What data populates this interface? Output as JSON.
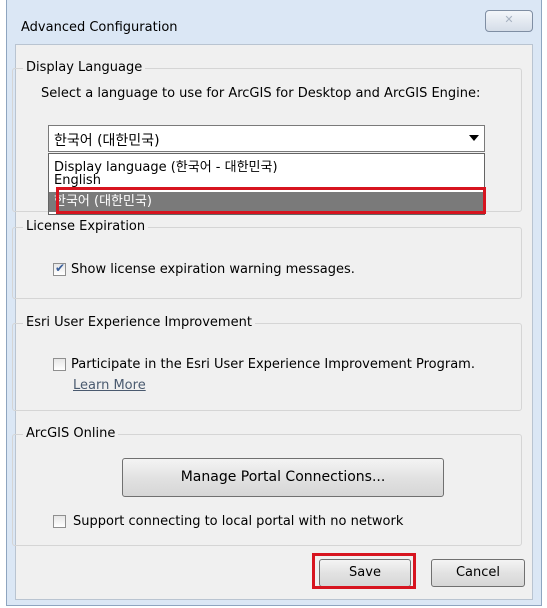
{
  "window": {
    "title": "Advanced Configuration",
    "close_glyph": "✕"
  },
  "display_language": {
    "legend": "Display Language",
    "instruction": "Select a language to use for ArcGIS for Desktop and ArcGIS Engine:",
    "selected_value": "한국어 (대한민국)",
    "options": [
      "Display language (한국어 - 대한민국)",
      "English",
      "한국어 (대한민국)"
    ],
    "highlighted_option_index": 2
  },
  "license_expiration": {
    "legend": "License Expiration",
    "checkbox_label": "Show license expiration warning messages.",
    "checked": true
  },
  "uei": {
    "legend": "Esri User Experience Improvement",
    "checkbox_label": "Participate in the Esri User Experience Improvement Program.",
    "checked": false,
    "learn_more": "Learn More"
  },
  "arcgis_online": {
    "legend": "ArcGIS Online",
    "manage_button": "Manage Portal Connections...",
    "checkbox_label": "Support connecting to local portal with no network",
    "checked": false
  },
  "footer": {
    "save": "Save",
    "cancel": "Cancel"
  },
  "colors": {
    "highlight_red": "#d7141f",
    "selected_option": "#7a7a7a",
    "check_mark": "#3a5f9a"
  }
}
